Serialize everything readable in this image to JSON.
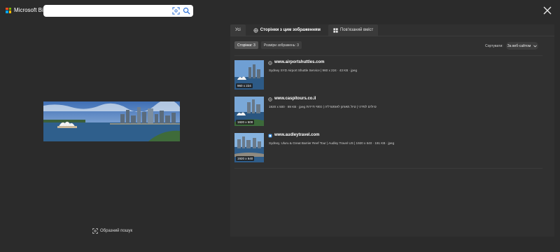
{
  "header": {
    "brand": "Microsoft Bing",
    "search_value": ""
  },
  "left": {
    "visual_search_label": "Образний пошук"
  },
  "tabs": [
    {
      "label": "Усі",
      "icon": ""
    },
    {
      "label": "Сторінки з цим зображенням",
      "icon": "globe-search-icon"
    },
    {
      "label": "Пов'язаний вміст",
      "icon": "grid-icon"
    }
  ],
  "filters": {
    "pages_chip": "Сторінки: 3",
    "sizes_chip": "Розміри зображень: 3",
    "sort_label": "Сортувати:",
    "sort_value": "За веб-сайтом"
  },
  "results": [
    {
      "site": "www.airportshuttles.com",
      "desc": "Sydney SYD Airport Shuttle Service | 960 x 224 · 43 KB · jpeg",
      "dims": "960 x 224",
      "favicon": "globe-icon"
    },
    {
      "site": "www.caspitours.co.il",
      "desc": "1920 x 500 · 89 KB · jpeg טיולים לסידני | טיול מאורגן לאוסטרליה | כספי תיירות",
      "dims": "1920 x 500",
      "favicon": "globe-icon"
    },
    {
      "site": "www.audleytravel.com",
      "desc": "Sydney, Uluru & Great Barrier Reef Tour | Audley Travel US | 1920 x 640 · 191 KB · jpeg",
      "dims": "1920 x 640",
      "favicon": "site-square-icon"
    }
  ],
  "colors": {
    "background": "#2b2b2b",
    "panel": "#303030",
    "accent": "#4aa3ff"
  }
}
